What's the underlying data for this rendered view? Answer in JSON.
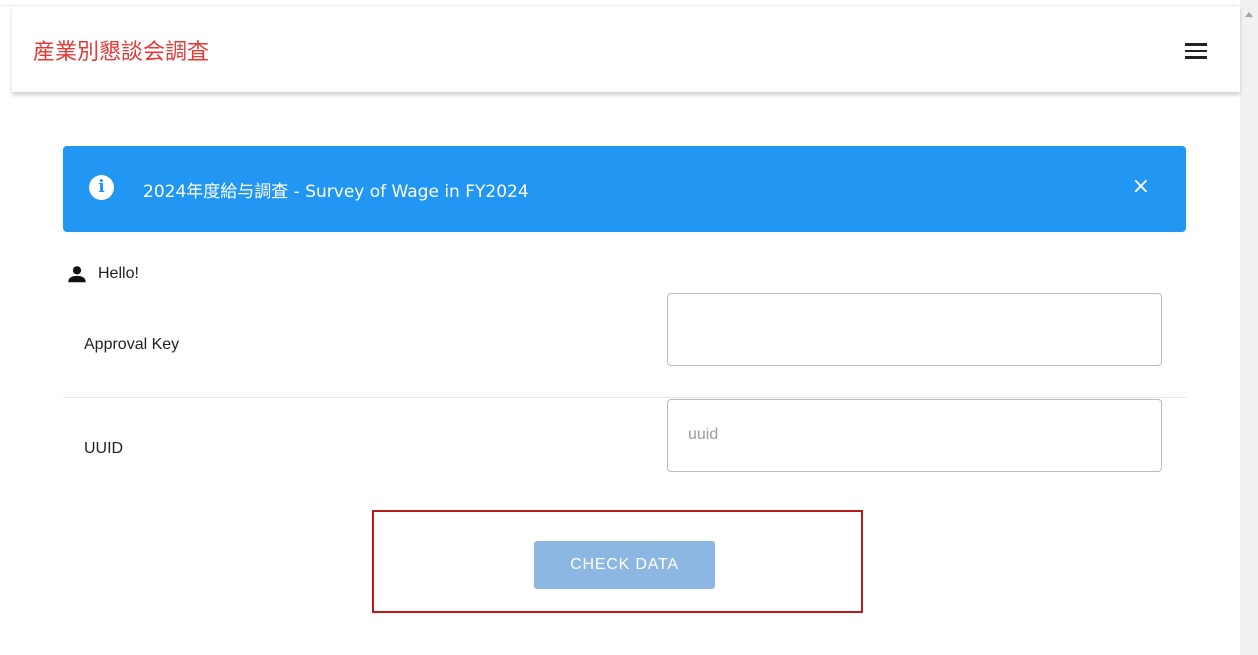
{
  "header": {
    "title": "産業別懇談会調査",
    "menu_icon": "hamburger-menu-icon"
  },
  "alert": {
    "icon": "info-icon",
    "icon_glyph": "i",
    "text": "2024年度給与調査 - Survey of Wage in FY2024",
    "close_glyph": "×",
    "background": "#2196f3"
  },
  "greeting": {
    "icon": "person-icon",
    "text": "Hello!"
  },
  "form": {
    "approval_key": {
      "label": "Approval Key",
      "value": "",
      "placeholder": ""
    },
    "uuid": {
      "label": "UUID",
      "value": "",
      "placeholder": "uuid"
    }
  },
  "actions": {
    "check_data_label": "CHECK DATA"
  },
  "colors": {
    "title": "#e53935",
    "button": "#8db7e3",
    "highlight": "#b71c1c"
  }
}
